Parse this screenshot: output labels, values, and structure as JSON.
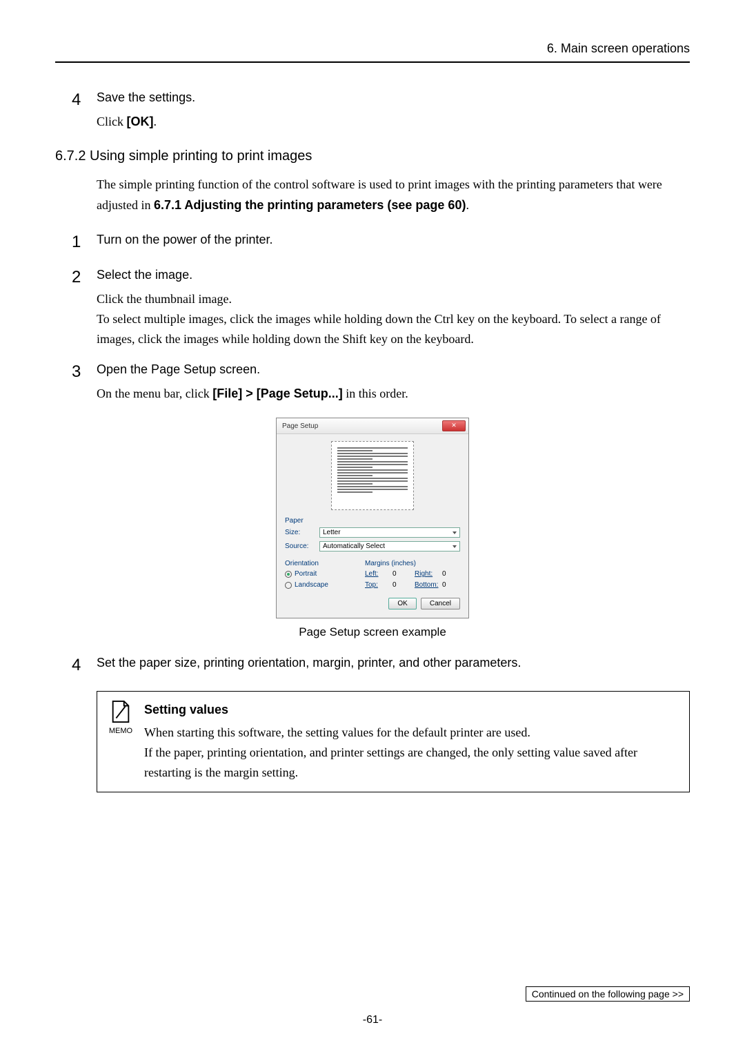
{
  "header": {
    "chapter": "6. Main screen operations"
  },
  "step4_top": {
    "num": "4",
    "title": "Save the settings.",
    "text_prefix": "Click ",
    "text_bold": "[OK]",
    "text_suffix": "."
  },
  "section": {
    "heading": "6.7.2 Using simple printing to print images",
    "intro_prefix": "The simple printing function of the control software is used to print images with the printing parameters that were adjusted in ",
    "intro_bold": "6.7.1 Adjusting the printing parameters (see page 60)",
    "intro_suffix": "."
  },
  "step1": {
    "num": "1",
    "title": "Turn on the power of the printer."
  },
  "step2": {
    "num": "2",
    "title": "Select the image.",
    "text": "Click the thumbnail image.\nTo select multiple images, click the images while holding down the Ctrl key on the keyboard. To select a range of images, click the images while holding down the Shift key on the keyboard."
  },
  "step3": {
    "num": "3",
    "title": "Open the Page Setup screen.",
    "text_prefix": "On the menu bar, click ",
    "text_bold": "[File] > [Page Setup...]",
    "text_suffix": " in this order."
  },
  "dialog": {
    "title": "Page Setup",
    "paper_label": "Paper",
    "size_label": "Size:",
    "size_value": "Letter",
    "source_label": "Source:",
    "source_value": "Automatically Select",
    "orientation_label": "Orientation",
    "portrait": "Portrait",
    "landscape": "Landscape",
    "margins_label": "Margins (inches)",
    "left_label": "Left:",
    "left_value": "0",
    "right_label": "Right:",
    "right_value": "0",
    "top_label": "Top:",
    "top_value": "0",
    "bottom_label": "Bottom:",
    "bottom_value": "0",
    "ok": "OK",
    "cancel": "Cancel"
  },
  "caption": "Page Setup screen example",
  "step4": {
    "num": "4",
    "title": "Set the paper size, printing orientation, margin, printer, and other parameters."
  },
  "memo": {
    "icon_label": "MEMO",
    "title": "Setting values",
    "line1": "When starting this software, the setting values for the default printer are used.",
    "line2": "If the paper, printing orientation, and printer settings are changed, the only setting value saved after restarting is the margin setting."
  },
  "footer": {
    "continue": "Continued on the following page >>",
    "page": "-61-"
  }
}
